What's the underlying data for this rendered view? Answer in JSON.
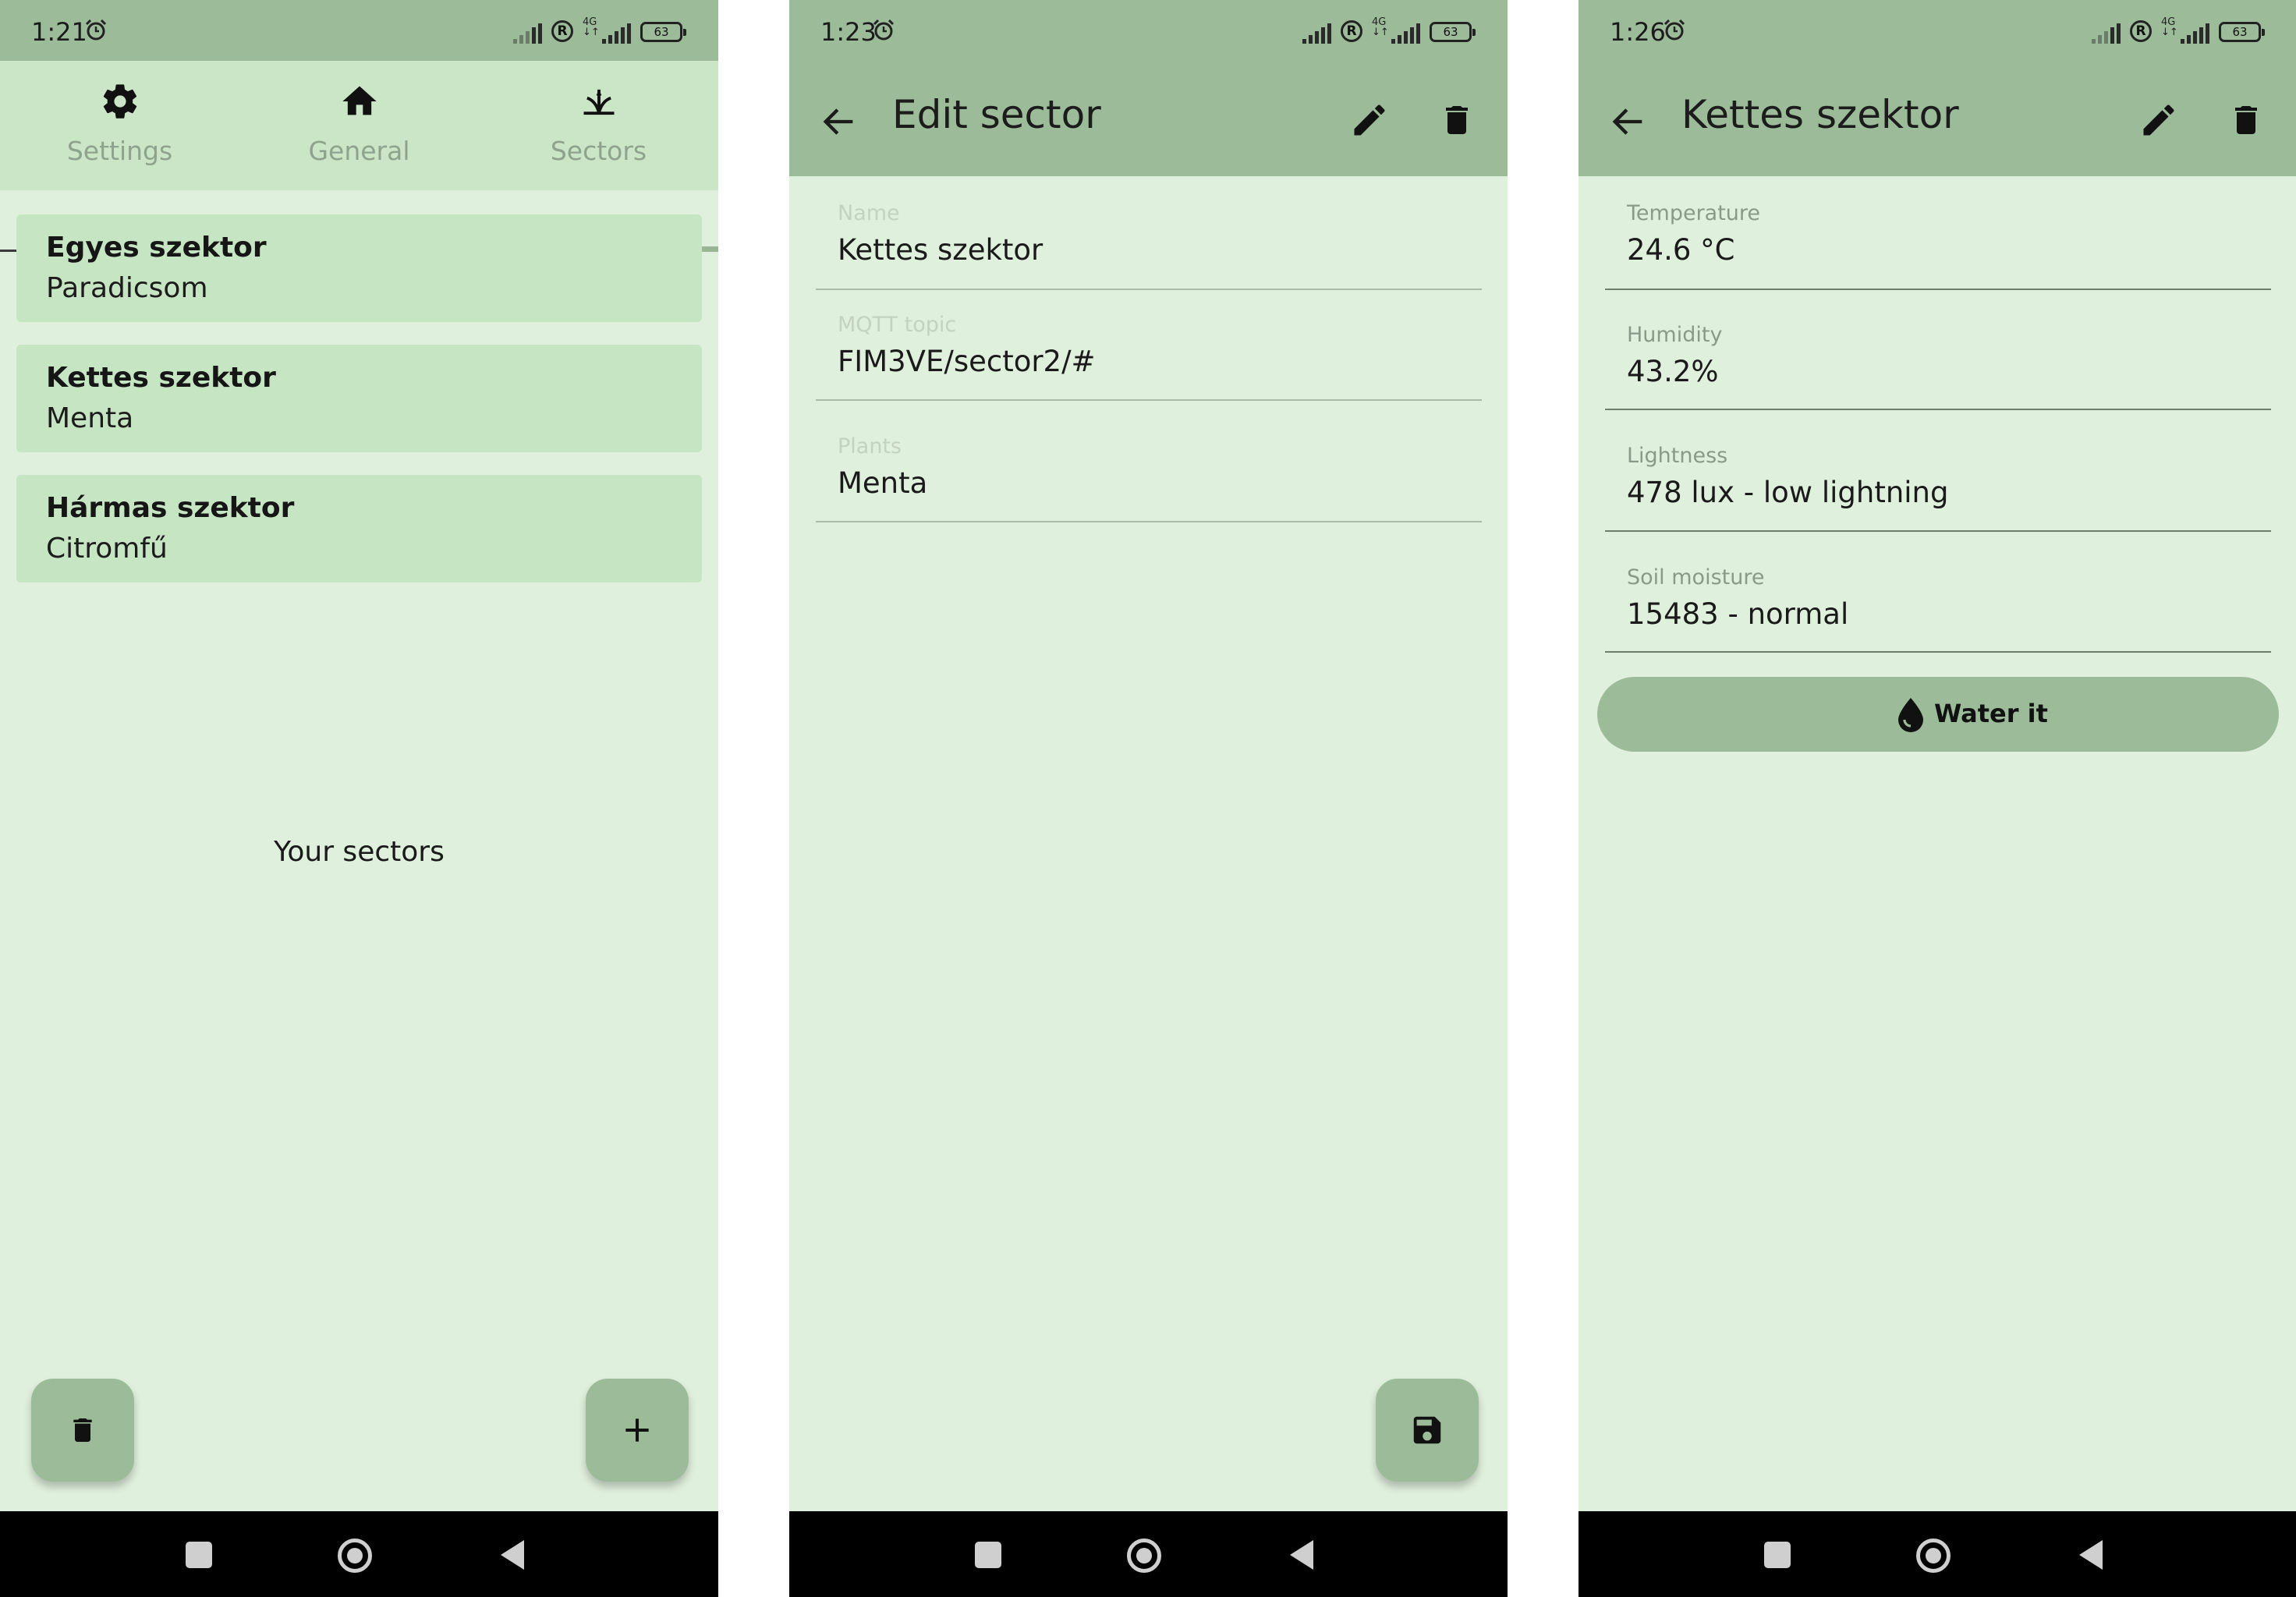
{
  "screens": {
    "list": {
      "status": {
        "time": "1:21",
        "battery": "63"
      },
      "tabs": [
        {
          "label": "Settings",
          "icon": "gear-icon"
        },
        {
          "label": "General",
          "icon": "home-icon"
        },
        {
          "label": "Sectors",
          "icon": "grass-icon"
        }
      ],
      "sectors": [
        {
          "name": "Egyes szektor",
          "plant": "Paradicsom"
        },
        {
          "name": "Kettes szektor",
          "plant": "Menta"
        },
        {
          "name": "Hármas szektor",
          "plant": "Citromfű"
        }
      ],
      "empty_label": "Your sectors",
      "fab_left_icon": "trash-icon",
      "fab_right_icon": "plus-icon"
    },
    "edit": {
      "status": {
        "time": "1:23",
        "battery": "63"
      },
      "title": "Edit sector",
      "fields": [
        {
          "label": "Name",
          "value": "Kettes szektor"
        },
        {
          "label": "MQTT topic",
          "value": "FIM3VE/sector2/#"
        },
        {
          "label": "Plants",
          "value": "Menta"
        }
      ],
      "fab_icon": "save-icon"
    },
    "detail": {
      "status": {
        "time": "1:26",
        "battery": "63"
      },
      "title": "Kettes szektor",
      "readings": [
        {
          "label": "Temperature",
          "value": "24.6 °C"
        },
        {
          "label": "Humidity",
          "value": "43.2%"
        },
        {
          "label": "Lightness",
          "value": "478 lux - low lightning"
        },
        {
          "label": "Soil moisture",
          "value": "15483 - normal"
        }
      ],
      "water_button": {
        "label": "Water it",
        "icon": "water-drop-icon"
      }
    }
  },
  "colors": {
    "statusbar": "#9cbc99",
    "tabbar": "#cbe6c7",
    "background": "#dff0dc",
    "card": "#c6e5c2",
    "accent": "#9cbc99",
    "navbar": "#000000"
  }
}
